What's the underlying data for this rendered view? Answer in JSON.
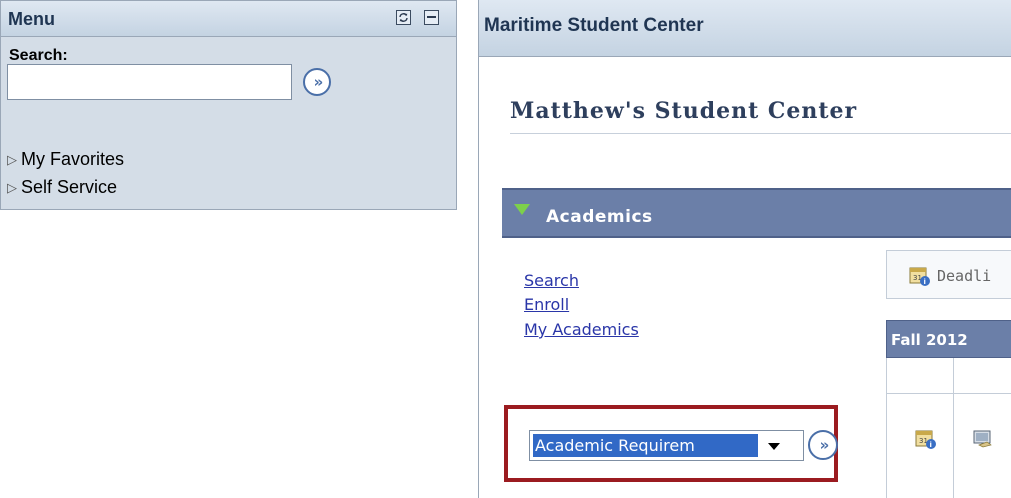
{
  "menu": {
    "title": "Menu",
    "search_label": "Search:",
    "search_value": "",
    "go_icon": "double-chevron-right-icon",
    "items": [
      {
        "label": "My Favorites",
        "icon": "triangle-right-icon"
      },
      {
        "label": "Self Service",
        "icon": "triangle-right-icon"
      }
    ],
    "header_icons": [
      "refresh-icon",
      "minimize-icon"
    ]
  },
  "student_center": {
    "header_title": "Maritime Student Center",
    "page_title": "Matthew's Student Center",
    "academics": {
      "section_label": "Academics",
      "links": [
        "Search",
        "Enroll",
        "My Academics"
      ],
      "deadlines_label": "Deadli",
      "term_label": "Fall 2012",
      "other_academic_select": "Academic Requirem"
    }
  },
  "colors": {
    "section_bar": "#6b7fa8",
    "link": "#2a36a8",
    "highlight_border": "#9b1b20",
    "selected_option_bg": "#3169c6"
  }
}
